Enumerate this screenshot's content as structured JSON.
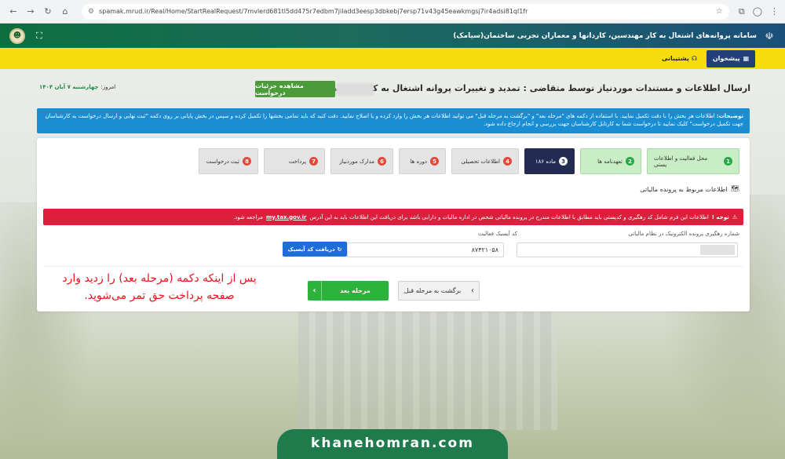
{
  "browser": {
    "url": "spamak.mrud.ir/Real/Home/StartRealRequest/7mvlerd681tl5dd475r7edbm7jiladd3eesp3dbkebj7ersp71v43g45eawkmgsj7ir4adsi81ql1fr"
  },
  "header": {
    "title": "سامانه پروانه‌های اشتغال به کار مهندسین، کاردانها و معماران تجربی ساختمان(سیامک)"
  },
  "nav": {
    "dashboard_label": "پیشخوان",
    "support_label": "پشتیبانی"
  },
  "page": {
    "title": "ارسال اطلاعات و مستندات موردنیاز توسط متقاضی : تمدید و تغییرات پروانه اشتغال به کار مهندسی شخص حقیقی",
    "details_button": "مشاهده جزئیات درخواست",
    "date_prefix": "امروز:",
    "date_value": "چهارشنبه ۷ آبان ۱۴۰۴"
  },
  "info": {
    "label": "توضیحات:",
    "text": "اطلاعات هر بخش را با دقت تکمیل نمایید. با استفاده از دکمه های \"مرحله بعد\" و \"برگشت به مرحله قبل\" می توانید اطلاعات هر بخش را وارد کرده و یا اصلاح نمایید. دقت کنید که باید تمامی بخشها را تکمیل کرده و سپس در بخش پایانی بر روی دکمه \"ثبت نهایی و ارسال درخواست به کارشناسان جهت تکمیل درخواست\" کلیک نمایید تا درخواست شما به کارتابل کارشناسان جهت بررسی و انجام ارجاع داده شود."
  },
  "steps": [
    {
      "num": "1",
      "label": "محل فعالیت و اطلاعات پستی",
      "state": "done"
    },
    {
      "num": "2",
      "label": "تعهدنامه ها",
      "state": "done"
    },
    {
      "num": "3",
      "label": "ماده ۱۸۶",
      "state": "active"
    },
    {
      "num": "4",
      "label": "اطلاعات تحصیلی",
      "state": "pending"
    },
    {
      "num": "5",
      "label": "دوره ها",
      "state": "pending"
    },
    {
      "num": "6",
      "label": "مدارک موردنیاز",
      "state": "pending"
    },
    {
      "num": "7",
      "label": "پرداخت",
      "state": "pending"
    },
    {
      "num": "8",
      "label": "ثبت درخواست",
      "state": "pending"
    }
  ],
  "section": {
    "title": "اطلاعات مربوط به پرونده مالیاتی"
  },
  "warning": {
    "label": "توجه !",
    "text": "اطلاعات این فرم شامل کد رهگیری و کدپستی باید مطابق با اطلاعات مندرج در پرونده مالیاتی شخص در اداره مالیات و دارایی باشد برای دریافت این اطلاعات باید به این آدرس",
    "link": "my.tax.gov.ir",
    "suffix": "مراجعه شود."
  },
  "form": {
    "tax_tracking_label": "شماره رهگیری پرونده الکترونیک در نظام مالیاتی",
    "isic_label": "کد آیسیک فعالیت",
    "isic_value": "۸۷۴۲۱۰۵۸",
    "get_code_button": "دریافت کد آیسیک"
  },
  "buttons": {
    "next": "مرحله بعد",
    "prev": "برگشت به مرحله قبل"
  },
  "annotation": {
    "line1": "پس از اینکه دکمه (مرحله بعد) را زدید وارد",
    "line2": "صفحه پرداخت حق تمر می‌شوید."
  },
  "brand": {
    "text": "khanehomran.com"
  },
  "colors": {
    "header_green": "#0d6e3f",
    "yellow_nav": "#f7dd0d",
    "info_blue": "#1b8ed3",
    "warning_red": "#dc1f3c",
    "active_step": "#232b52",
    "next_green": "#2db33b",
    "annotation_red": "#e8141b"
  }
}
